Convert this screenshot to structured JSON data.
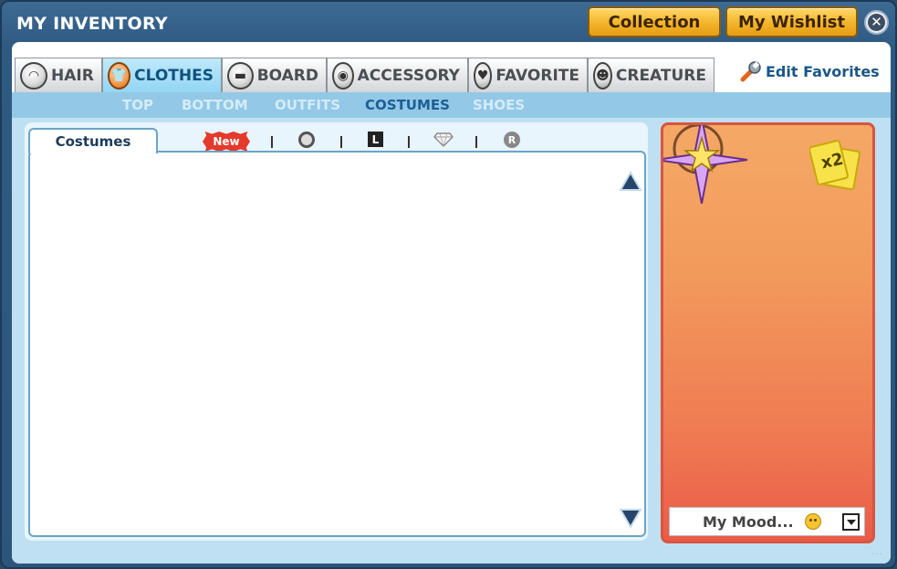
{
  "window": {
    "title": "MY INVENTORY"
  },
  "header": {
    "collection_label": "Collection",
    "wishlist_label": "My Wishlist",
    "close_icon": "close-icon"
  },
  "tabs": [
    {
      "label": "HAIR",
      "icon": "hair-icon",
      "active": false
    },
    {
      "label": "CLOTHES",
      "icon": "shirt-icon",
      "active": true
    },
    {
      "label": "BOARD",
      "icon": "board-icon",
      "active": false
    },
    {
      "label": "ACCESSORY",
      "icon": "goggles-icon",
      "active": false
    },
    {
      "label": "FAVORITE",
      "icon": "heart-icon",
      "active": false
    },
    {
      "label": "CREATURE",
      "icon": "creature-icon",
      "active": false
    }
  ],
  "edit_favorites_label": "Edit Favorites",
  "subcategories": [
    {
      "label": "TOP",
      "active": false
    },
    {
      "label": "BOTTOM",
      "active": false
    },
    {
      "label": "OUTFITS",
      "active": false
    },
    {
      "label": "COSTUMES",
      "active": true
    },
    {
      "label": "SHOES",
      "active": false
    }
  ],
  "list_panel": {
    "tab_label": "Costumes",
    "filters": {
      "new_label": "New",
      "limited_label": "L",
      "rare_label": "R"
    }
  },
  "avatar_panel": {
    "multiplier_label": "x2",
    "mood_label": "My Mood..."
  },
  "colors": {
    "frame": "#2e5a82",
    "active_tab": "#93d5f4",
    "gold_button": "#f3b42a",
    "panel_top": "#f5a866",
    "panel_bottom": "#ea5b48"
  }
}
